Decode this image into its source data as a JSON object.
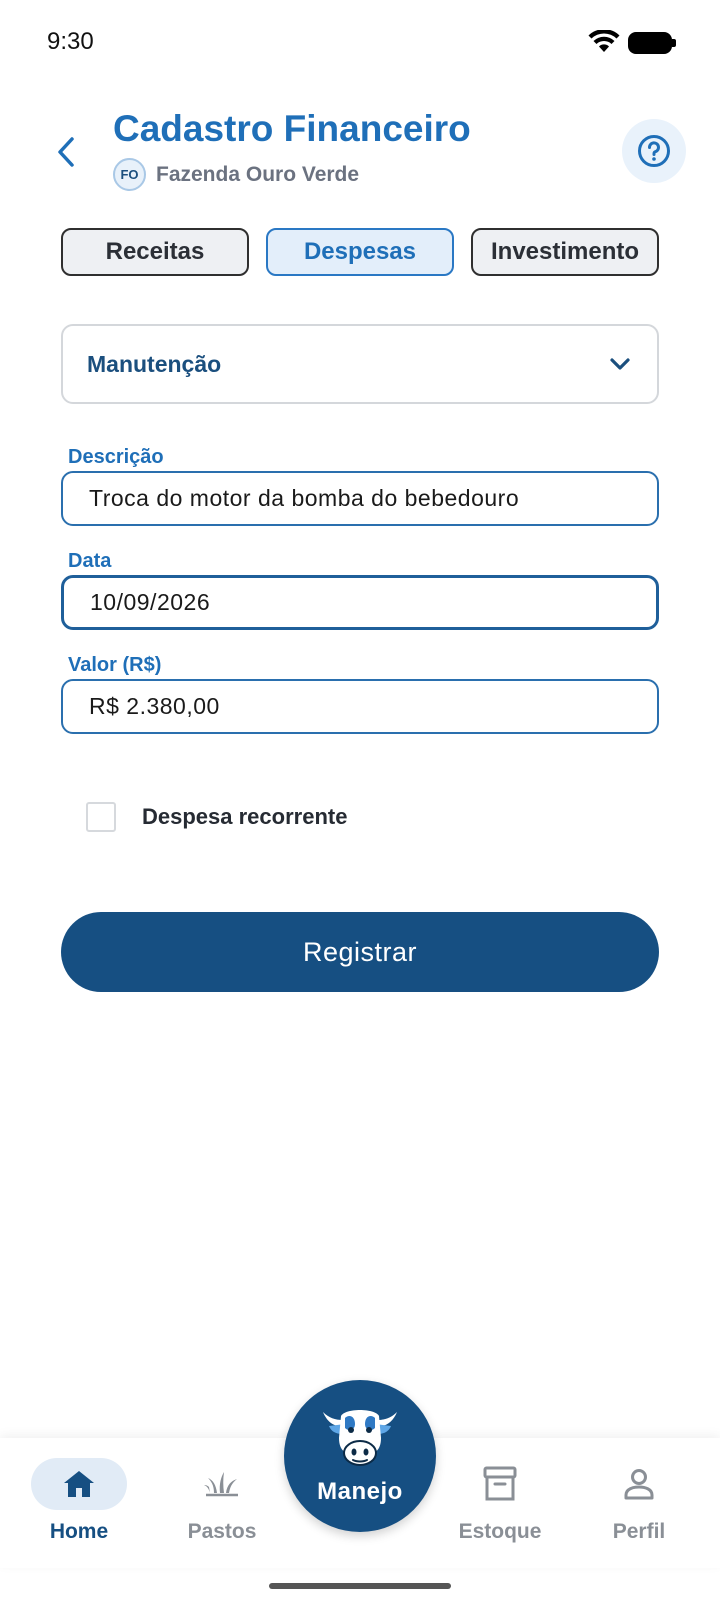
{
  "status_bar": {
    "time": "9:30",
    "wifi_icon": "wifi-icon",
    "battery_icon": "battery-icon"
  },
  "header": {
    "title": "Cadastro Financeiro",
    "farm_initials": "FO",
    "farm_name": "Fazenda Ouro Verde",
    "back_icon": "chevron-left-icon",
    "help_icon": "help-circle-icon"
  },
  "tabs": [
    {
      "label": "Receitas",
      "active": false
    },
    {
      "label": "Despesas",
      "active": true
    },
    {
      "label": "Investimento",
      "active": false
    }
  ],
  "category": {
    "value": "Manutenção",
    "icon": "chevron-down-icon"
  },
  "form": {
    "description_label": "Descrição",
    "description_value": "Troca do motor da bomba do bebedouro",
    "date_label": "Data",
    "date_value": "10/09/2026",
    "amount_label": "Valor (R$)",
    "amount_value": "R$ 2.380,00",
    "recurring_label": "Despesa recorrente",
    "recurring_checked": false,
    "submit_label": "Registrar"
  },
  "bottom_nav": {
    "items": [
      {
        "label": "Home",
        "icon": "home-icon",
        "active": true
      },
      {
        "label": "Pastos",
        "icon": "grass-icon",
        "active": false
      },
      {
        "label": "Estoque",
        "icon": "archive-box-icon",
        "active": false
      },
      {
        "label": "Perfil",
        "icon": "person-icon",
        "active": false
      }
    ],
    "fab_label": "Manejo",
    "fab_icon": "cow-icon"
  },
  "colors": {
    "primary": "#164f82",
    "accent": "#1f6fb8",
    "tab_active_bg": "#e3eefa"
  }
}
